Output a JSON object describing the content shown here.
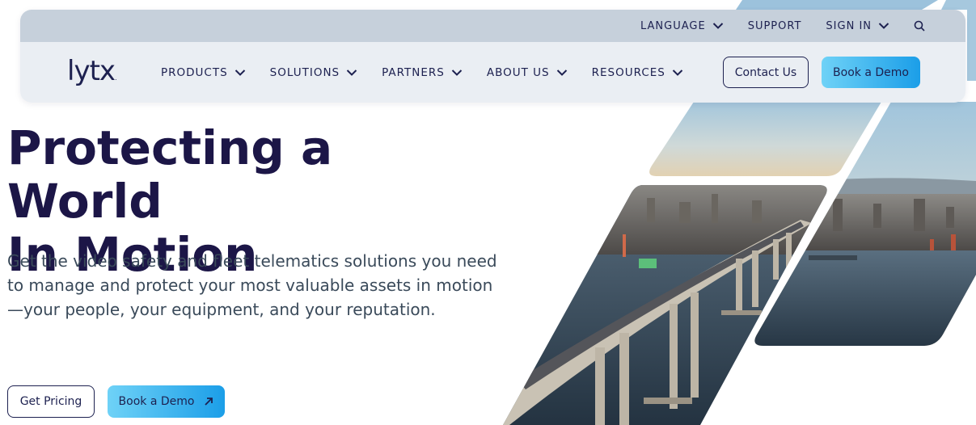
{
  "utility": {
    "language": "LANGUAGE",
    "support": "SUPPORT",
    "sign_in": "SIGN IN"
  },
  "brand": {
    "logo_text": "lytx",
    "logo_mark": "."
  },
  "menu": {
    "items": [
      {
        "label": "PRODUCTS"
      },
      {
        "label": "SOLUTIONS"
      },
      {
        "label": "PARTNERS"
      },
      {
        "label": "ABOUT US"
      },
      {
        "label": "RESOURCES"
      }
    ]
  },
  "nav_actions": {
    "contact": "Contact Us",
    "demo": "Book a Demo"
  },
  "hero": {
    "title_line1": "Protecting a World",
    "title_line2": "In Motion",
    "subtitle": "Get the video safety and fleet telematics solutions you need to manage and protect your most valuable assets in motion—your people, your equipment, and your reputation.",
    "cta_primary": "Get Pricing",
    "cta_secondary": "Book a Demo"
  },
  "colors": {
    "navy": "#1d2150",
    "accent_start": "#6fd2f7",
    "accent_end": "#1b9ee8"
  },
  "icons": {
    "search": "search-icon",
    "chevron": "chevron-down-icon",
    "arrow": "arrow-up-right-icon"
  }
}
